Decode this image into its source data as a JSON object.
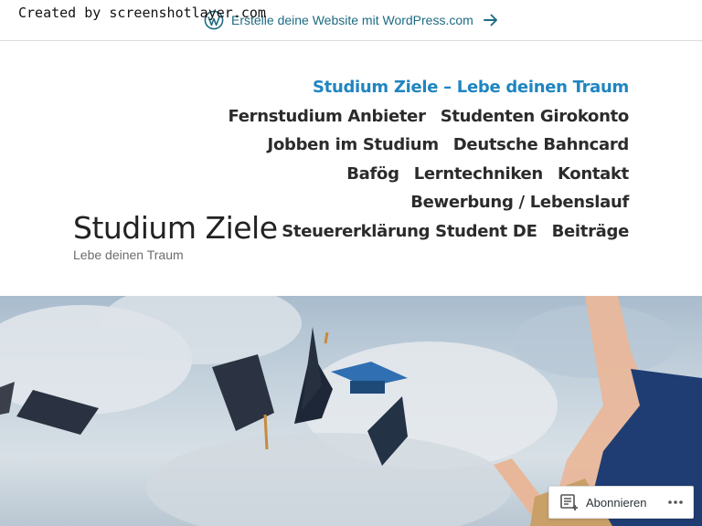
{
  "watermark": "Created by screenshotlayer.com",
  "wpbar": {
    "link_text": "Erstelle deine Website mit WordPress.com"
  },
  "site": {
    "title": "Studium Ziele",
    "description": "Lebe deinen Traum"
  },
  "nav": {
    "rows": [
      [
        {
          "label": "Studium Ziele – Lebe deinen Traum",
          "current": true
        }
      ],
      [
        {
          "label": "Fernstudium Anbieter"
        },
        {
          "label": "Studenten Girokonto"
        }
      ],
      [
        {
          "label": "Jobben im Studium"
        },
        {
          "label": "Deutsche Bahncard"
        }
      ],
      [
        {
          "label": "Bafög"
        },
        {
          "label": "Lerntechniken"
        },
        {
          "label": "Kontakt"
        }
      ],
      [
        {
          "label": "Bewerbung / Lebenslauf"
        }
      ],
      [
        {
          "label": "Steuererklärung Student DE"
        },
        {
          "label": "Beiträge"
        }
      ]
    ]
  },
  "subscribe": {
    "label": "Abonnieren"
  },
  "colors": {
    "link": "#1e6b82",
    "nav_current": "#1f85c1",
    "nav": "#2b2b2b"
  },
  "icons": [
    "wordpress-logo-icon",
    "arrow-right-icon",
    "reader-icon",
    "more-dots-icon"
  ]
}
